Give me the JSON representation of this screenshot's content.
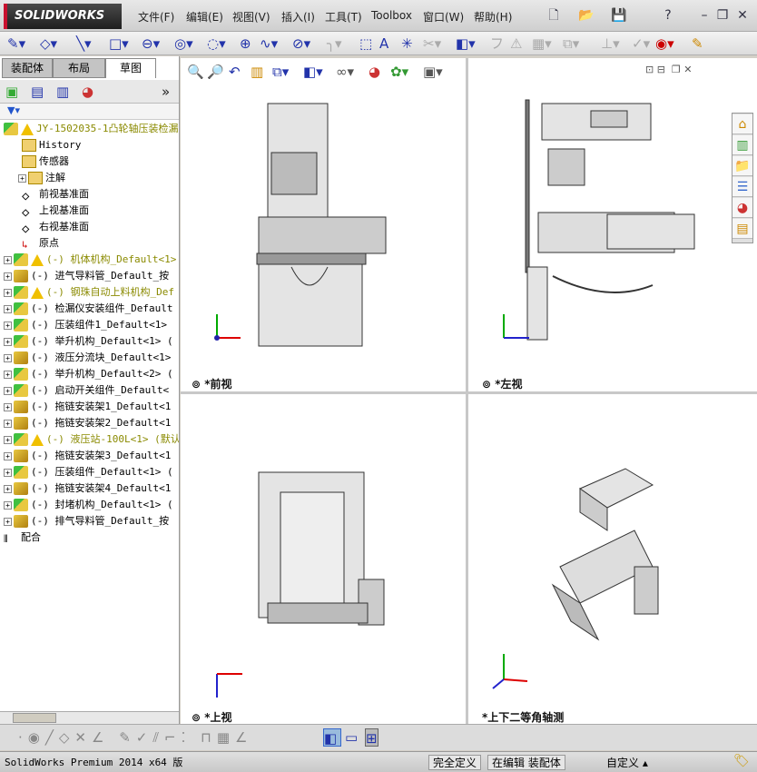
{
  "app": {
    "logo": "SOLIDWORKS"
  },
  "menu": [
    "文件(F)",
    "编辑(E)",
    "视图(V)",
    "插入(I)",
    "工具(T)",
    "Toolbox",
    "窗口(W)",
    "帮助(H)"
  ],
  "panel": {
    "tabs": [
      "装配体",
      "布局",
      "草图"
    ],
    "active_tab": "草图",
    "tree": [
      {
        "label": "JY-1502035-1凸轮轴压装检漏",
        "icon": "assembly-icon",
        "warn": true,
        "olive": true,
        "expand": false,
        "indent": 0
      },
      {
        "label": "History",
        "icon": "history-icon",
        "indent": 1
      },
      {
        "label": "传感器",
        "icon": "sensor-icon",
        "indent": 1
      },
      {
        "label": "注解",
        "icon": "annotation-icon",
        "expand": true,
        "indent": 1
      },
      {
        "label": "前视基准面",
        "icon": "plane-icon",
        "indent": 1
      },
      {
        "label": "上视基准面",
        "icon": "plane-icon",
        "indent": 1
      },
      {
        "label": "右视基准面",
        "icon": "plane-icon",
        "indent": 1
      },
      {
        "label": "原点",
        "icon": "origin-icon",
        "indent": 1
      },
      {
        "label": "(-) 机体机构_Default<1>",
        "icon": "subassembly-icon",
        "warn": true,
        "olive": true,
        "expand": true
      },
      {
        "label": "(-) 进气导料管_Default_按",
        "icon": "part-icon",
        "expand": true
      },
      {
        "label": "(-) 钢珠自动上料机构_Def",
        "icon": "subassembly-icon",
        "warn": true,
        "olive": true,
        "expand": true
      },
      {
        "label": "(-) 检漏仪安装组件_Default",
        "icon": "subassembly-icon",
        "expand": true
      },
      {
        "label": "(-) 压装组件1_Default<1>",
        "icon": "subassembly-icon",
        "expand": true
      },
      {
        "label": "(-) 举升机构_Default<1> (",
        "icon": "subassembly-icon",
        "expand": true
      },
      {
        "label": "(-) 液压分流块_Default<1>",
        "icon": "part-icon",
        "expand": true
      },
      {
        "label": "(-) 举升机构_Default<2> (",
        "icon": "subassembly-icon",
        "expand": true
      },
      {
        "label": "(-) 启动开关组件_Default<",
        "icon": "subassembly-icon",
        "expand": true
      },
      {
        "label": "(-) 拖链安装架1_Default<1",
        "icon": "part-icon",
        "expand": true
      },
      {
        "label": "(-) 拖链安装架2_Default<1",
        "icon": "part-icon",
        "expand": true
      },
      {
        "label": "(-) 液压站-100L<1> (默认",
        "icon": "subassembly-icon",
        "warn": true,
        "olive": true,
        "expand": true
      },
      {
        "label": "(-) 拖链安装架3_Default<1",
        "icon": "part-icon",
        "expand": true
      },
      {
        "label": "(-) 压装组件_Default<1> (",
        "icon": "subassembly-icon",
        "expand": true
      },
      {
        "label": "(-) 拖链安装架4_Default<1",
        "icon": "part-icon",
        "expand": true
      },
      {
        "label": "(-) 封堵机构_Default<1> (",
        "icon": "subassembly-icon",
        "expand": true
      },
      {
        "label": "(-) 排气导料管_Default_按",
        "icon": "part-icon",
        "expand": true
      },
      {
        "label": "配合",
        "icon": "mates-icon",
        "indent": 0
      }
    ]
  },
  "views": {
    "front": "*前视",
    "left": "*左视",
    "top": "*上视",
    "iso": "*上下二等角轴测"
  },
  "status": {
    "product": "SolidWorks Premium 2014 x64 版",
    "defined": "完全定义",
    "editing": "在编辑 装配体",
    "custom": "自定义"
  }
}
